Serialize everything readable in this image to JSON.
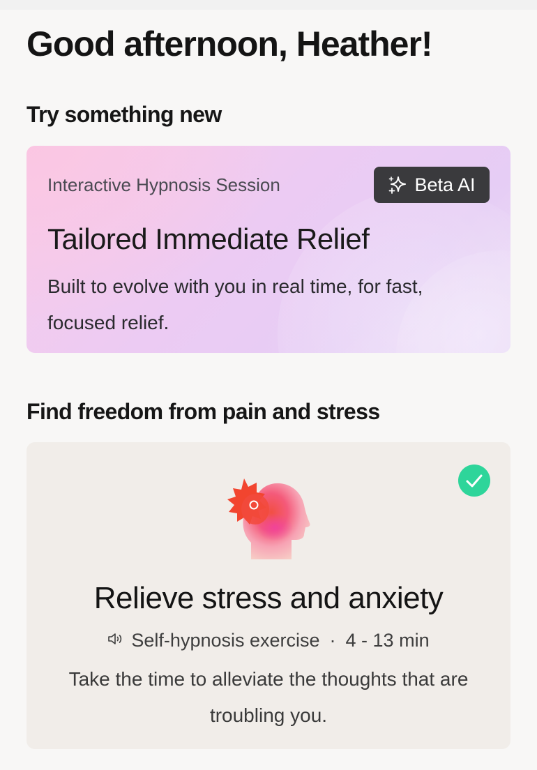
{
  "greeting": "Good afternoon, Heather!",
  "sections": {
    "try_new": {
      "title": "Try something new",
      "card": {
        "kicker": "Interactive Hypnosis Session",
        "badge": "Beta AI",
        "badge_icon": "sparkles-icon",
        "title": "Tailored Immediate Relief",
        "description": "Built to evolve with you in real time, for fast, focused relief."
      }
    },
    "freedom": {
      "title": "Find freedom from pain and stress",
      "card": {
        "title": "Relieve stress and anxiety",
        "type_icon": "speaker-icon",
        "type": "Self-hypnosis exercise",
        "separator": "·",
        "duration": "4 - 13 min",
        "description": "Take the time to alleviate the thoughts that are troubling you.",
        "completed": true,
        "illustration": "head-stress-illustration"
      }
    }
  },
  "colors": {
    "background": "#f8f7f6",
    "badge_bg": "#3a3a3d",
    "check_green": "#2ed59a",
    "exercise_card_bg": "#f1ede9",
    "burst_red": "#f2452f"
  }
}
